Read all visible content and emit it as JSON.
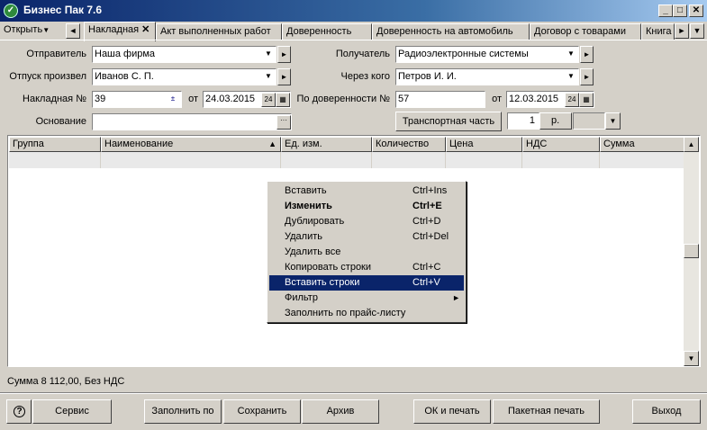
{
  "window": {
    "title": "Бизнес Пак 7.6"
  },
  "menu": {
    "open_label": "Открыть"
  },
  "tabs": [
    {
      "label": "Накладная",
      "active": true
    },
    {
      "label": "Акт выполненных работ"
    },
    {
      "label": "Доверенность"
    },
    {
      "label": "Доверенность на автомобиль"
    },
    {
      "label": "Договор с товарами"
    },
    {
      "label": "Книга"
    }
  ],
  "form": {
    "sender_label": "Отправитель",
    "sender_value": "Наша фирма",
    "released_label": "Отпуск произвел",
    "released_value": "Иванов С. П.",
    "invoice_no_label": "Накладная №",
    "invoice_no_value": "39",
    "date_from_label": "от",
    "invoice_date": "24.03.2015",
    "basis_label": "Основание",
    "basis_value": "",
    "recipient_label": "Получатель",
    "recipient_value": "Радиоэлектронные системы",
    "via_label": "Через кого",
    "via_value": "Петров И. И.",
    "poa_label": "По доверенности №",
    "poa_value": "57",
    "poa_date_label": "от",
    "poa_date": "12.03.2015",
    "transport_button": "Транспортная часть",
    "copies_value": "1",
    "copies_unit": "р.",
    "calendar_icon_text": "24"
  },
  "grid": {
    "columns": [
      "Группа",
      "Наименование",
      "Ед. изм.",
      "Количество",
      "Цена",
      "НДС",
      "Сумма"
    ],
    "sorted_column": "Наименование"
  },
  "context_menu": [
    {
      "label": "Вставить",
      "shortcut": "Ctrl+Ins"
    },
    {
      "label": "Изменить",
      "shortcut": "Ctrl+E",
      "bold": true
    },
    {
      "label": "Дублировать",
      "shortcut": "Ctrl+D"
    },
    {
      "label": "Удалить",
      "shortcut": "Ctrl+Del"
    },
    {
      "label": "Удалить все",
      "shortcut": ""
    },
    {
      "label": "Копировать строки",
      "shortcut": "Ctrl+C"
    },
    {
      "label": "Вставить строки",
      "shortcut": "Ctrl+V",
      "selected": true
    },
    {
      "label": "Фильтр",
      "shortcut": "",
      "submenu": true
    },
    {
      "label": "Заполнить по прайс-листу",
      "shortcut": ""
    }
  ],
  "status": {
    "total": "Сумма 8 112,00, Без НДС"
  },
  "buttons": {
    "service": "Сервис",
    "fill_by": "Заполнить по",
    "save": "Сохранить",
    "archive": "Архив",
    "ok_print": "ОК и печать",
    "batch_print": "Пакетная печать",
    "exit": "Выход"
  },
  "colors": {
    "title_bar": "#0a246a",
    "selection": "#0a246a",
    "face": "#d4d0c8"
  }
}
